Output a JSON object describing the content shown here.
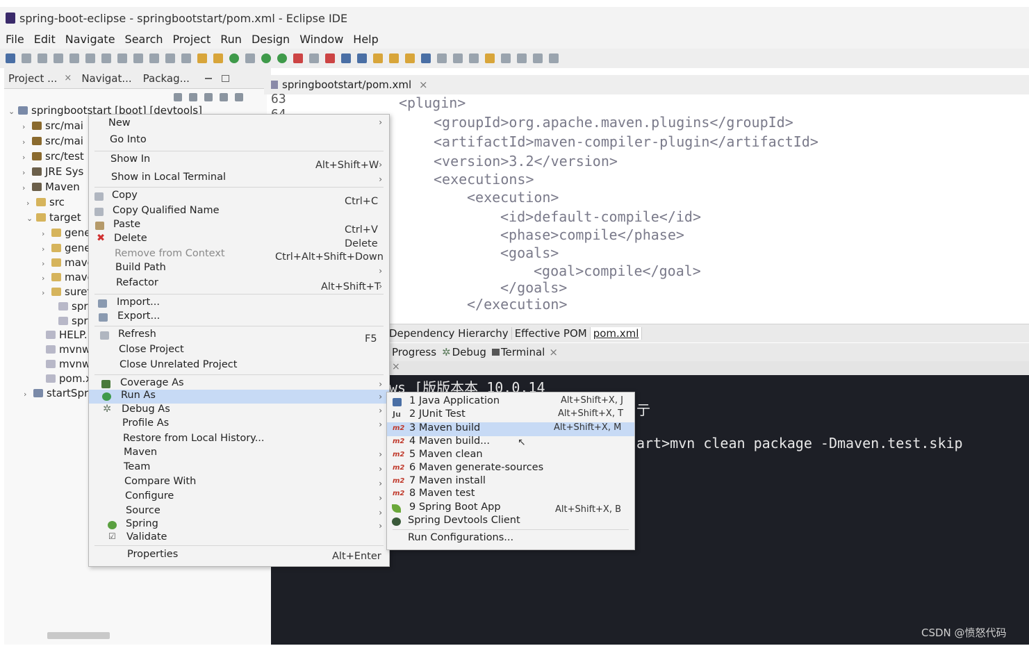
{
  "window": {
    "title": "spring-boot-eclipse - springbootstart/pom.xml - Eclipse IDE"
  },
  "menubar": [
    "File",
    "Edit",
    "Navigate",
    "Search",
    "Project",
    "Run",
    "Design",
    "Window",
    "Help"
  ],
  "left_tabs": [
    {
      "label": "Project ...",
      "close": "×"
    },
    {
      "label": "Navigat..."
    },
    {
      "label": "Packag..."
    }
  ],
  "tree": [
    {
      "label": "springbootstart [boot] [devtools]",
      "chevron": "⌄",
      "icon": "project-icon"
    },
    {
      "label": "src/mai",
      "chevron": "›",
      "icon": "package-folder-icon"
    },
    {
      "label": "src/mai",
      "chevron": "›",
      "icon": "package-folder-icon"
    },
    {
      "label": "src/test",
      "chevron": "›",
      "icon": "package-folder-icon"
    },
    {
      "label": "JRE Sys",
      "chevron": "›",
      "icon": "library-icon"
    },
    {
      "label": "Maven",
      "chevron": "›",
      "icon": "library-icon"
    },
    {
      "label": "src",
      "chevron": "›",
      "icon": "folder-icon"
    },
    {
      "label": "target",
      "chevron": "⌄",
      "icon": "folder-icon"
    },
    {
      "label": "gene",
      "chevron": "›",
      "icon": "folder-icon"
    },
    {
      "label": "gene",
      "chevron": "›",
      "icon": "folder-icon"
    },
    {
      "label": "mave",
      "chevron": "›",
      "icon": "folder-icon"
    },
    {
      "label": "mave",
      "chevron": "›",
      "icon": "folder-icon"
    },
    {
      "label": "suref",
      "chevron": "›",
      "icon": "folder-icon"
    },
    {
      "label": "sprin",
      "chevron": "",
      "icon": "file-icon"
    },
    {
      "label": "sprin",
      "chevron": "",
      "icon": "file-icon"
    },
    {
      "label": "HELP.m",
      "chevron": "",
      "icon": "file-icon"
    },
    {
      "label": "mvnw",
      "chevron": "",
      "icon": "file-icon"
    },
    {
      "label": "mvnw.c",
      "chevron": "",
      "icon": "file-icon"
    },
    {
      "label": "pom.xn",
      "chevron": "",
      "icon": "file-icon"
    },
    {
      "label": "startSpring",
      "chevron": "›",
      "icon": "project-icon"
    }
  ],
  "editor": {
    "tab": "springbootstart/pom.xml",
    "tab_close": "×",
    "line_numbers": [
      "63",
      "64"
    ],
    "lines": [
      "<plugin>",
      "<groupId>org.apache.maven.plugins</groupId>",
      "<artifactId>maven-compiler-plugin</artifactId>",
      "<version>3.2</version>",
      "<executions>",
      "<execution>",
      "<id>default-compile</id>",
      "<phase>compile</phase>",
      "<goals>",
      "<goal>compile</goal>",
      "</goals>",
      "</execution>"
    ]
  },
  "pom_tabs": [
    "Dependency Hierarchy",
    "Effective POM",
    "pom.xml"
  ],
  "view_tabs": [
    "Progress",
    "Debug",
    "Terminal"
  ],
  "terminal": {
    "close": "×",
    "line1": "ws [版版本本 10.0.14",
    "line2_tail": "亍",
    "line3": "art>mvn clean package -Dmaven.test.skip"
  },
  "context_menu": [
    {
      "label": "New",
      "submenu": true
    },
    {
      "label": "Go Into"
    },
    {
      "label": "Show In",
      "shortcut": "Alt+Shift+W",
      "submenu": true
    },
    {
      "label": "Show in Local Terminal",
      "submenu": true
    },
    {
      "label": "Copy",
      "shortcut": "Ctrl+C",
      "icon": "copy-icon"
    },
    {
      "label": "Copy Qualified Name",
      "icon": "copy-qualified-icon"
    },
    {
      "label": "Paste",
      "shortcut": "Ctrl+V",
      "icon": "paste-icon"
    },
    {
      "label": "Delete",
      "shortcut": "Delete",
      "icon": "delete-icon"
    },
    {
      "label": "Remove from Context",
      "shortcut": "Ctrl+Alt+Shift+Down",
      "disabled": true
    },
    {
      "label": "Build Path",
      "submenu": true
    },
    {
      "label": "Refactor",
      "shortcut": "Alt+Shift+T",
      "submenu": true
    },
    {
      "label": "Import...",
      "icon": "import-icon"
    },
    {
      "label": "Export...",
      "icon": "export-icon"
    },
    {
      "label": "Refresh",
      "shortcut": "F5",
      "icon": "refresh-icon"
    },
    {
      "label": "Close Project"
    },
    {
      "label": "Close Unrelated Project"
    },
    {
      "label": "Coverage As",
      "submenu": true,
      "icon": "coverage-icon"
    },
    {
      "label": "Run As",
      "submenu": true,
      "icon": "run-icon",
      "highlighted": true
    },
    {
      "label": "Debug As",
      "submenu": true,
      "icon": "debug-icon"
    },
    {
      "label": "Profile As",
      "submenu": true
    },
    {
      "label": "Restore from Local History..."
    },
    {
      "label": "Maven",
      "submenu": true
    },
    {
      "label": "Team",
      "submenu": true
    },
    {
      "label": "Compare With",
      "submenu": true
    },
    {
      "label": "Configure",
      "submenu": true
    },
    {
      "label": "Source",
      "submenu": true
    },
    {
      "label": "Spring",
      "submenu": true,
      "icon": "spring-icon"
    },
    {
      "label": "Validate",
      "icon": "validate-checkbox-icon"
    },
    {
      "label": "Properties",
      "shortcut": "Alt+Enter"
    }
  ],
  "run_as_menu": [
    {
      "label": "1 Java Application",
      "shortcut": "Alt+Shift+X, J",
      "icon": "java-app-icon"
    },
    {
      "label": "2 JUnit Test",
      "shortcut": "Alt+Shift+X, T",
      "icon": "junit-icon",
      "badge": "Ju"
    },
    {
      "label": "3 Maven build",
      "shortcut": "Alt+Shift+X, M",
      "icon": "maven-m2-icon",
      "badge": "m2",
      "highlighted": true
    },
    {
      "label": "4 Maven build...",
      "icon": "maven-m2-icon",
      "badge": "m2"
    },
    {
      "label": "5 Maven clean",
      "icon": "maven-m2-icon",
      "badge": "m2"
    },
    {
      "label": "6 Maven generate-sources",
      "icon": "maven-m2-icon",
      "badge": "m2"
    },
    {
      "label": "7 Maven install",
      "icon": "maven-m2-icon",
      "badge": "m2"
    },
    {
      "label": "8 Maven test",
      "icon": "maven-m2-icon",
      "badge": "m2"
    },
    {
      "label": "9 Spring Boot App",
      "shortcut": "Alt+Shift+X, B",
      "icon": "spring-boot-icon"
    },
    {
      "label": "Spring Devtools Client",
      "icon": "devtools-icon"
    },
    {
      "label": "Run Configurations..."
    }
  ],
  "watermark": "CSDN @愤怒代码",
  "colors": {
    "highlight": "#c7daf5",
    "terminal_bg": "#1d1f26",
    "editor_text": "#7a7a8a"
  }
}
